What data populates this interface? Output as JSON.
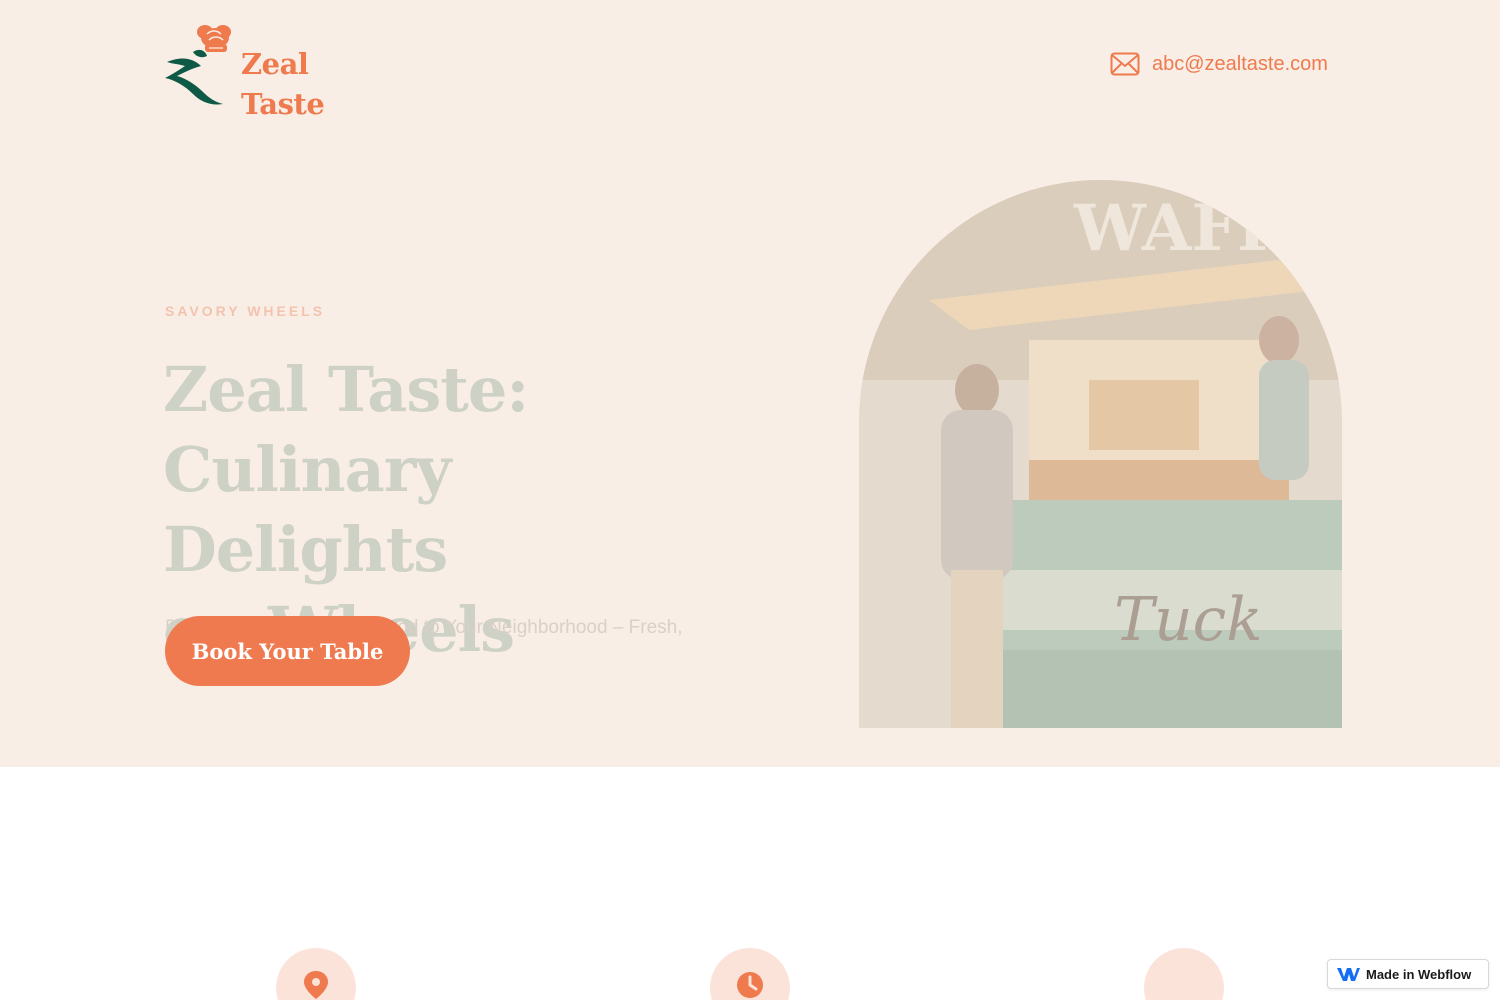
{
  "brand": {
    "name": "Zeal Taste",
    "logo_icon": "chef-hat-logo-icon",
    "color_primary": "#ee7a4e",
    "color_dark_green": "#0f5a46",
    "color_hero_bg": "#f9eee6"
  },
  "header": {
    "contact_icon": "mail-icon",
    "contact_email": "abc@zealtaste.com"
  },
  "hero": {
    "eyebrow": "SAVORY WHEELS",
    "title_line1": "Zeal Taste:",
    "title_line2": "Culinary Delights",
    "title_line3": "on Wheels",
    "subtitle": "Bringing Gourmet Street Food to Your Neighborhood – Fresh, Fast, and Flavorful!",
    "cta_label": "Book Your Table",
    "image_alt": "Customer at a waffle food truck at night"
  },
  "features": {
    "items": [
      {
        "icon": "map-pin-icon"
      },
      {
        "icon": "clock-icon"
      },
      {
        "icon": "feature-icon"
      }
    ]
  },
  "badge": {
    "label": "Made in Webflow",
    "icon": "webflow-icon"
  }
}
